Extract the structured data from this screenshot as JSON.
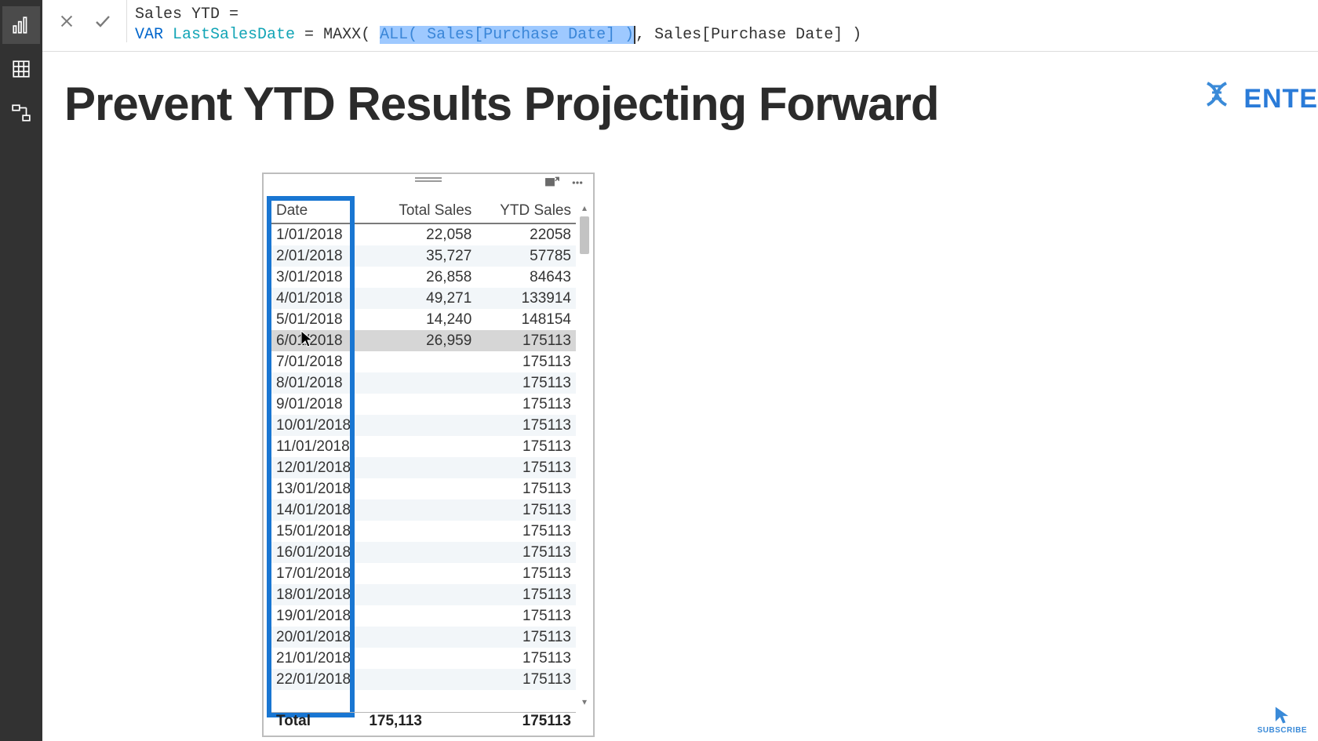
{
  "formula": {
    "measure_name": "Sales YTD",
    "eq": " = ",
    "line2_prefix": "VAR ",
    "var_name": "LastSalesDate",
    "assign_eq": " = ",
    "fn_maxx": "MAXX( ",
    "sel_all": "ALL( Sales[Purchase Date] )",
    "mid": ", ",
    "arg2": "Sales[Purchase Date] )"
  },
  "page": {
    "title": "Prevent YTD Results Projecting Forward",
    "brand_text": "ENTE"
  },
  "table": {
    "headers": {
      "c1": "Date",
      "c2": "Total Sales",
      "c3": "YTD Sales"
    },
    "rows": [
      {
        "date": "1/01/2018",
        "total": "22,058",
        "ytd": "22058"
      },
      {
        "date": "2/01/2018",
        "total": "35,727",
        "ytd": "57785"
      },
      {
        "date": "3/01/2018",
        "total": "26,858",
        "ytd": "84643"
      },
      {
        "date": "4/01/2018",
        "total": "49,271",
        "ytd": "133914"
      },
      {
        "date": "5/01/2018",
        "total": "14,240",
        "ytd": "148154"
      },
      {
        "date": "6/01/2018",
        "total": "26,959",
        "ytd": "175113"
      },
      {
        "date": "7/01/2018",
        "total": "",
        "ytd": "175113"
      },
      {
        "date": "8/01/2018",
        "total": "",
        "ytd": "175113"
      },
      {
        "date": "9/01/2018",
        "total": "",
        "ytd": "175113"
      },
      {
        "date": "10/01/2018",
        "total": "",
        "ytd": "175113"
      },
      {
        "date": "11/01/2018",
        "total": "",
        "ytd": "175113"
      },
      {
        "date": "12/01/2018",
        "total": "",
        "ytd": "175113"
      },
      {
        "date": "13/01/2018",
        "total": "",
        "ytd": "175113"
      },
      {
        "date": "14/01/2018",
        "total": "",
        "ytd": "175113"
      },
      {
        "date": "15/01/2018",
        "total": "",
        "ytd": "175113"
      },
      {
        "date": "16/01/2018",
        "total": "",
        "ytd": "175113"
      },
      {
        "date": "17/01/2018",
        "total": "",
        "ytd": "175113"
      },
      {
        "date": "18/01/2018",
        "total": "",
        "ytd": "175113"
      },
      {
        "date": "19/01/2018",
        "total": "",
        "ytd": "175113"
      },
      {
        "date": "20/01/2018",
        "total": "",
        "ytd": "175113"
      },
      {
        "date": "21/01/2018",
        "total": "",
        "ytd": "175113"
      },
      {
        "date": "22/01/2018",
        "total": "",
        "ytd": "175113"
      }
    ],
    "hover_index": 5,
    "total": {
      "label": "Total",
      "total": "175,113",
      "ytd": "175113"
    }
  },
  "subscribe_label": "SUBSCRIBE"
}
